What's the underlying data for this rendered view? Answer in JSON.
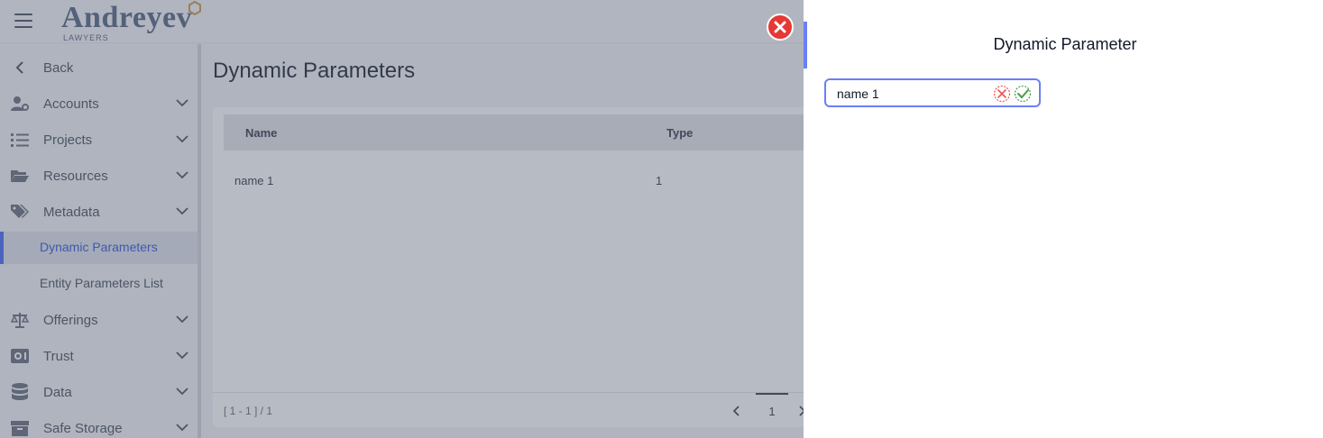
{
  "app": {
    "logo": {
      "word": "Andreyev",
      "sub": "LAWYERS"
    },
    "page_title": "Dynamic Parameters",
    "sidebar": {
      "back": "Back",
      "items": [
        {
          "label": "Accounts",
          "icon": "user-cog-icon"
        },
        {
          "label": "Projects",
          "icon": "list-icon"
        },
        {
          "label": "Resources",
          "icon": "folder-open-icon"
        },
        {
          "label": "Metadata",
          "icon": "tags-icon"
        }
      ],
      "sub_items": [
        {
          "label": "Dynamic Parameters",
          "active": true
        },
        {
          "label": "Entity Parameters List",
          "active": false
        }
      ],
      "items_after": [
        {
          "label": "Offerings",
          "icon": "scale-icon"
        },
        {
          "label": "Trust",
          "icon": "safe-icon"
        },
        {
          "label": "Data",
          "icon": "database-icon"
        },
        {
          "label": "Safe Storage",
          "icon": "archive-icon"
        }
      ]
    },
    "table": {
      "columns": [
        "Name",
        "Type"
      ],
      "rows": [
        [
          "name 1",
          "1"
        ]
      ],
      "range": "[ 1 - 1 ] / 1",
      "page": "1"
    }
  },
  "panel": {
    "title": "Dynamic Parameter",
    "name_value": "name 1"
  },
  "colors": {
    "accent": "#6b7ff5",
    "close": "#e53935",
    "cancel": "#ef5350",
    "confirm": "#43a047",
    "active_nav": "#3b5bdb"
  }
}
